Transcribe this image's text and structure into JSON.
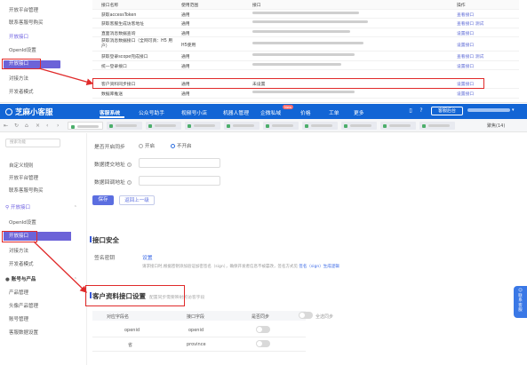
{
  "top_screenshot": {
    "sidebar": [
      {
        "label": "开放平台管理"
      },
      {
        "label": "联系客服号购买"
      },
      {
        "label": "开放接口",
        "section": true
      },
      {
        "label": "OpenId设置"
      },
      {
        "label": "开放接口",
        "active": true
      },
      {
        "label": "对接方法"
      },
      {
        "label": "开发者模式"
      }
    ],
    "table_header": [
      "接口名称",
      "使用范围",
      "接口",
      "操作"
    ],
    "rows": [
      {
        "name": "获取accessToken",
        "scope": "通用",
        "action": "查看接口"
      },
      {
        "name": "获取客服生成访客地址",
        "scope": "通用",
        "action": "查看接口 测试"
      },
      {
        "name": "直面消息数据查询",
        "scope": "通用",
        "action": "设置接口"
      },
      {
        "name": "获取消息数据接口（全网可真：H5 用户）",
        "scope": "H5使用",
        "action": "设置接口"
      },
      {
        "name": "获取登录scope完成接口",
        "scope": "通用",
        "action": "查看接口 测试"
      },
      {
        "name": "统一登录接口",
        "scope": "通用",
        "action": "设置接口"
      },
      {
        "name": "客户资料同步接口",
        "scope": "通用",
        "api": "未设置",
        "action": "设置接口"
      },
      {
        "name": "数据库推送",
        "scope": "通用",
        "action": "设置接口"
      }
    ]
  },
  "header": {
    "logo": "芝麻小客服",
    "nav": [
      "客服系统",
      "公众号助手",
      "视频号小店",
      "机器人管理",
      "企微私域",
      "价格",
      "工单",
      "更多"
    ],
    "new_badge": "New",
    "workspace_button": "客服后台"
  },
  "tabs": {
    "count_label": "聚焦(14)"
  },
  "sidebar": {
    "search_placeholder": "搜索功能",
    "items": [
      {
        "label": "自定义规则"
      },
      {
        "label": "开放平台管理"
      },
      {
        "label": "联系客服号购买"
      },
      {
        "label": "开放接口",
        "section": true
      },
      {
        "label": "OpenId设置"
      },
      {
        "label": "开放接口",
        "active": true
      },
      {
        "label": "对接方法"
      },
      {
        "label": "开发者模式"
      },
      {
        "label": "账号与产品",
        "section": true
      },
      {
        "label": "产品管理"
      },
      {
        "label": "头像产品管理"
      },
      {
        "label": "账号管理"
      },
      {
        "label": "客服数据设置"
      }
    ]
  },
  "main": {
    "sync_label": "是否开启同步",
    "radio_on": "开启",
    "radio_off": "不开启",
    "field1": "数据提交地址",
    "field2": "数据回调地址",
    "save": "保存",
    "back": "返回上一级",
    "security_title": "接口安全",
    "sign_label": "签名密钥",
    "sign_link": "设置",
    "sign_note": "请求接口时,根据密钥添加验证加密签名（sign），确保开发者信息不被篡改，签名方式见",
    "sign_note_link": "签名（sign）生成逻辑",
    "profile_title": "客户资料接口设置",
    "profile_sub": "配置同步需要映射的访客字段",
    "columns": [
      "对应字段名",
      "接口字段",
      "是否同步",
      "全选同步"
    ],
    "fields": [
      {
        "name": "openid",
        "key": "openid"
      },
      {
        "name": "省",
        "key": "province"
      }
    ]
  },
  "float_helper": "联系客服"
}
